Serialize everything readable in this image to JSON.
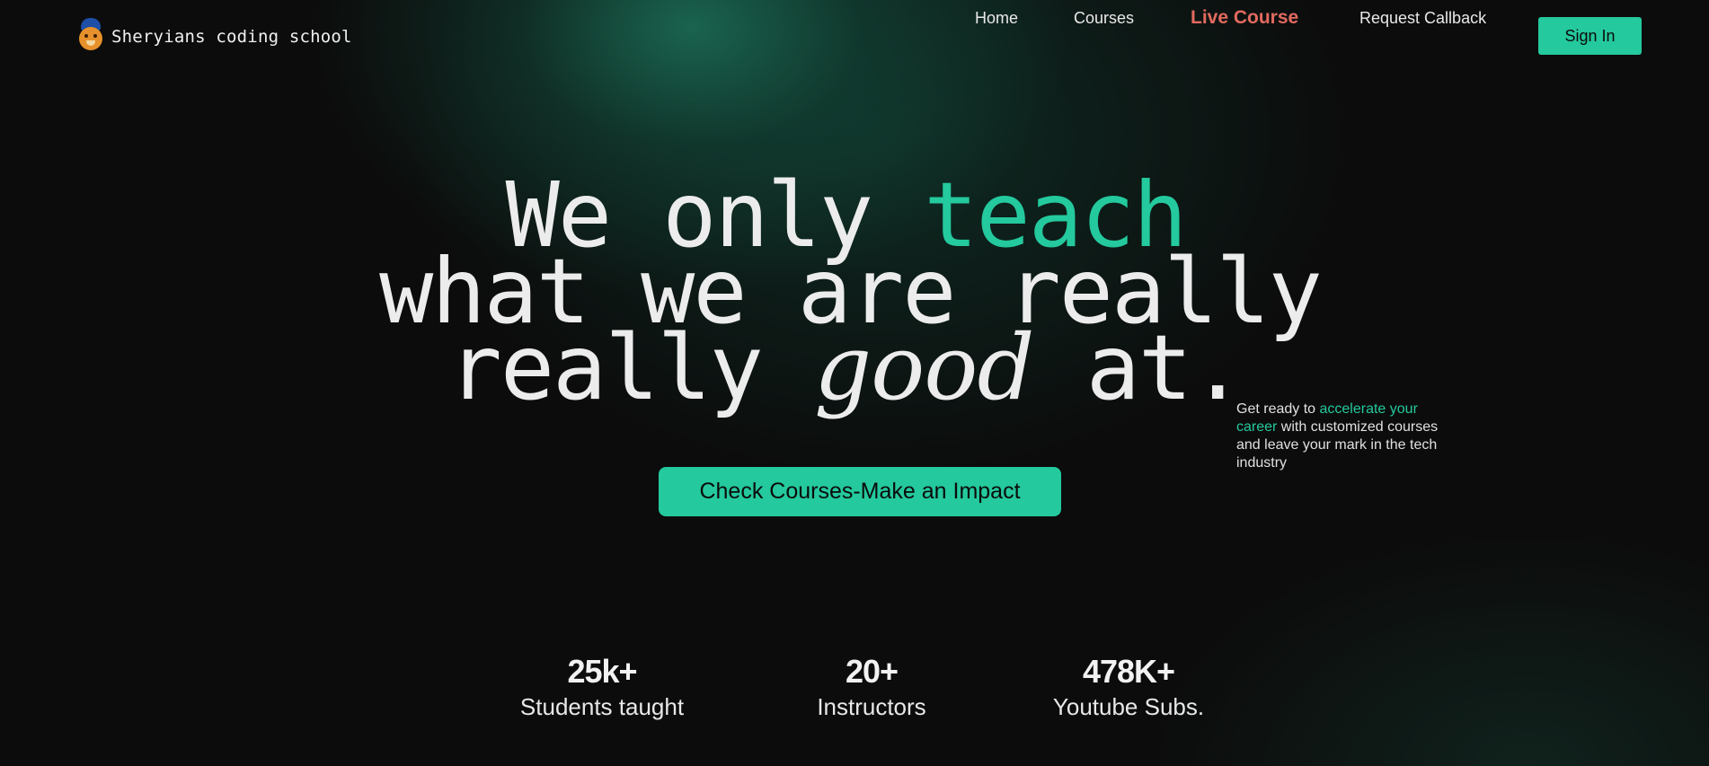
{
  "brand": {
    "name": "Sheryians coding school",
    "logo_icon": "lion-cap-logo-icon"
  },
  "nav": {
    "home": "Home",
    "courses": "Courses",
    "live_course": "Live Course",
    "request_callback": "Request Callback",
    "sign_in": "Sign In"
  },
  "hero": {
    "line1_a": "We only ",
    "line1_b": "teach",
    "line2": "what we are really",
    "line3_a": "really ",
    "line3_b": "good",
    "line3_c": " at.",
    "side_a": "Get ready to ",
    "side_b": "accelerate your career",
    "side_c": " with customized courses and leave your mark in the tech industry",
    "cta": "Check Courses-Make an Impact"
  },
  "stats": [
    {
      "value": "25k+",
      "label": "Students taught"
    },
    {
      "value": "20+",
      "label": "Instructors"
    },
    {
      "value": "478K+",
      "label": "Youtube Subs."
    }
  ],
  "colors": {
    "accent": "#24c99d",
    "live": "#e26a5f",
    "background": "#0c0c0c"
  }
}
